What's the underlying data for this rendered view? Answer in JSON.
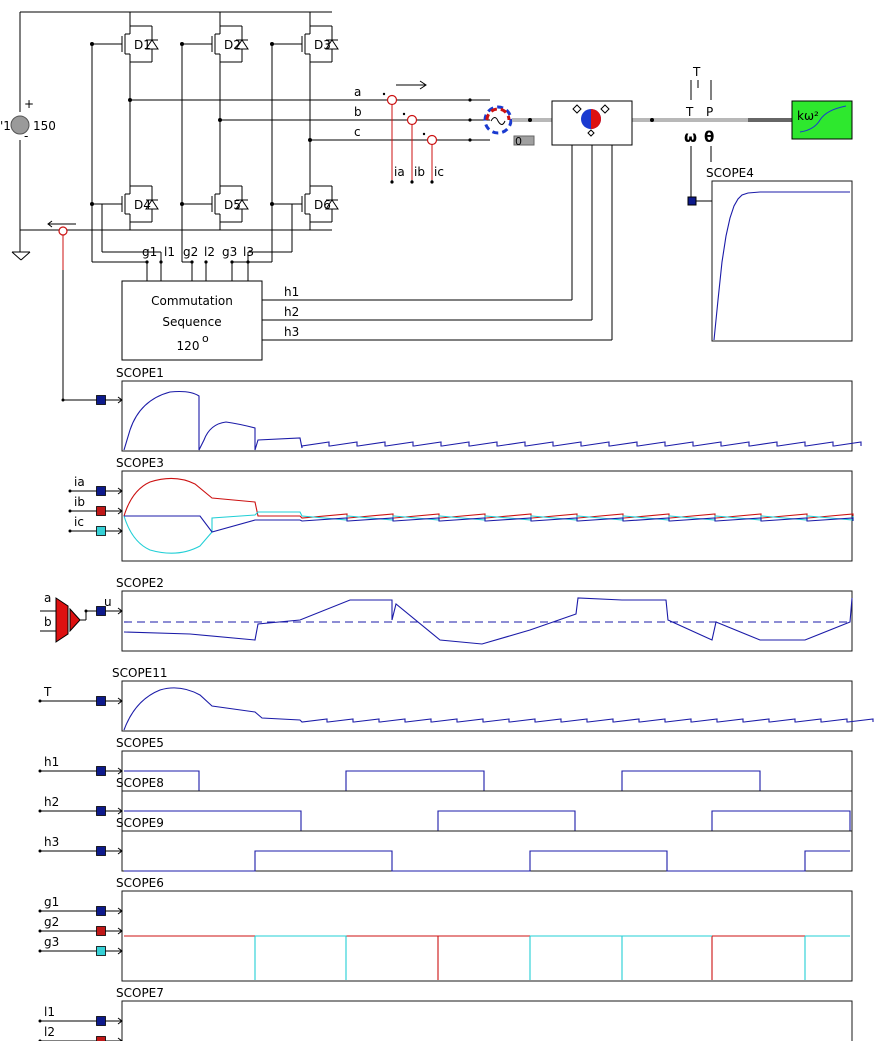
{
  "colors": {
    "trace_blue": "#1b1ba8",
    "trace_red": "#cc1111",
    "trace_cyan": "#22cfd6",
    "port_blue": "#0d1a8c",
    "port_red": "#c01818",
    "port_cyan": "#35d0d6",
    "load_green": "#2ee82e",
    "shaft_gray": "#b8b8b8"
  },
  "circuit": {
    "source_label": "150",
    "source_side_label": "'1",
    "plus": "+",
    "minus": "-",
    "switches": [
      "D1",
      "D2",
      "D3",
      "D4",
      "D5",
      "D6"
    ],
    "phase_labels": [
      "a",
      "b",
      "c"
    ],
    "current_probes": [
      "ia",
      "ib",
      "ic"
    ],
    "zero_block": "0",
    "gate_pins": [
      "g1",
      "l1",
      "g2",
      "l2",
      "g3",
      "l3"
    ],
    "hall_labels": [
      "h1",
      "h2",
      "h3"
    ],
    "commutation_block": {
      "line1": "Commutation",
      "line2": "Sequence",
      "angle": "120",
      "degree_symbol": "o"
    },
    "motor_port_labels": {
      "torque_top": "T",
      "torque": "T",
      "power": "P",
      "speed": "ω",
      "angle": "θ"
    },
    "load_label": "kω²"
  },
  "scopes": [
    {
      "id": "scope4",
      "title": "SCOPE4",
      "inputs": []
    },
    {
      "id": "scope1",
      "title": "SCOPE1",
      "inputs": []
    },
    {
      "id": "scope3",
      "title": "SCOPE3",
      "inputs": [
        "ia",
        "ib",
        "ic"
      ]
    },
    {
      "id": "scope2",
      "title": "SCOPE2",
      "inputs": [
        "a",
        "b",
        "u"
      ]
    },
    {
      "id": "scope11",
      "title": "SCOPE11",
      "inputs": [
        "T"
      ]
    },
    {
      "id": "scope5",
      "title": "SCOPE5",
      "inputs": [
        "h1"
      ]
    },
    {
      "id": "scope8",
      "title": "SCOPE8",
      "inputs": [
        "h2"
      ]
    },
    {
      "id": "scope9",
      "title": "SCOPE9",
      "inputs": [
        "h3"
      ]
    },
    {
      "id": "scope6",
      "title": "SCOPE6",
      "inputs": [
        "g1",
        "g2",
        "g3"
      ]
    },
    {
      "id": "scope7",
      "title": "SCOPE7",
      "inputs": [
        "l1",
        "l2"
      ]
    }
  ]
}
